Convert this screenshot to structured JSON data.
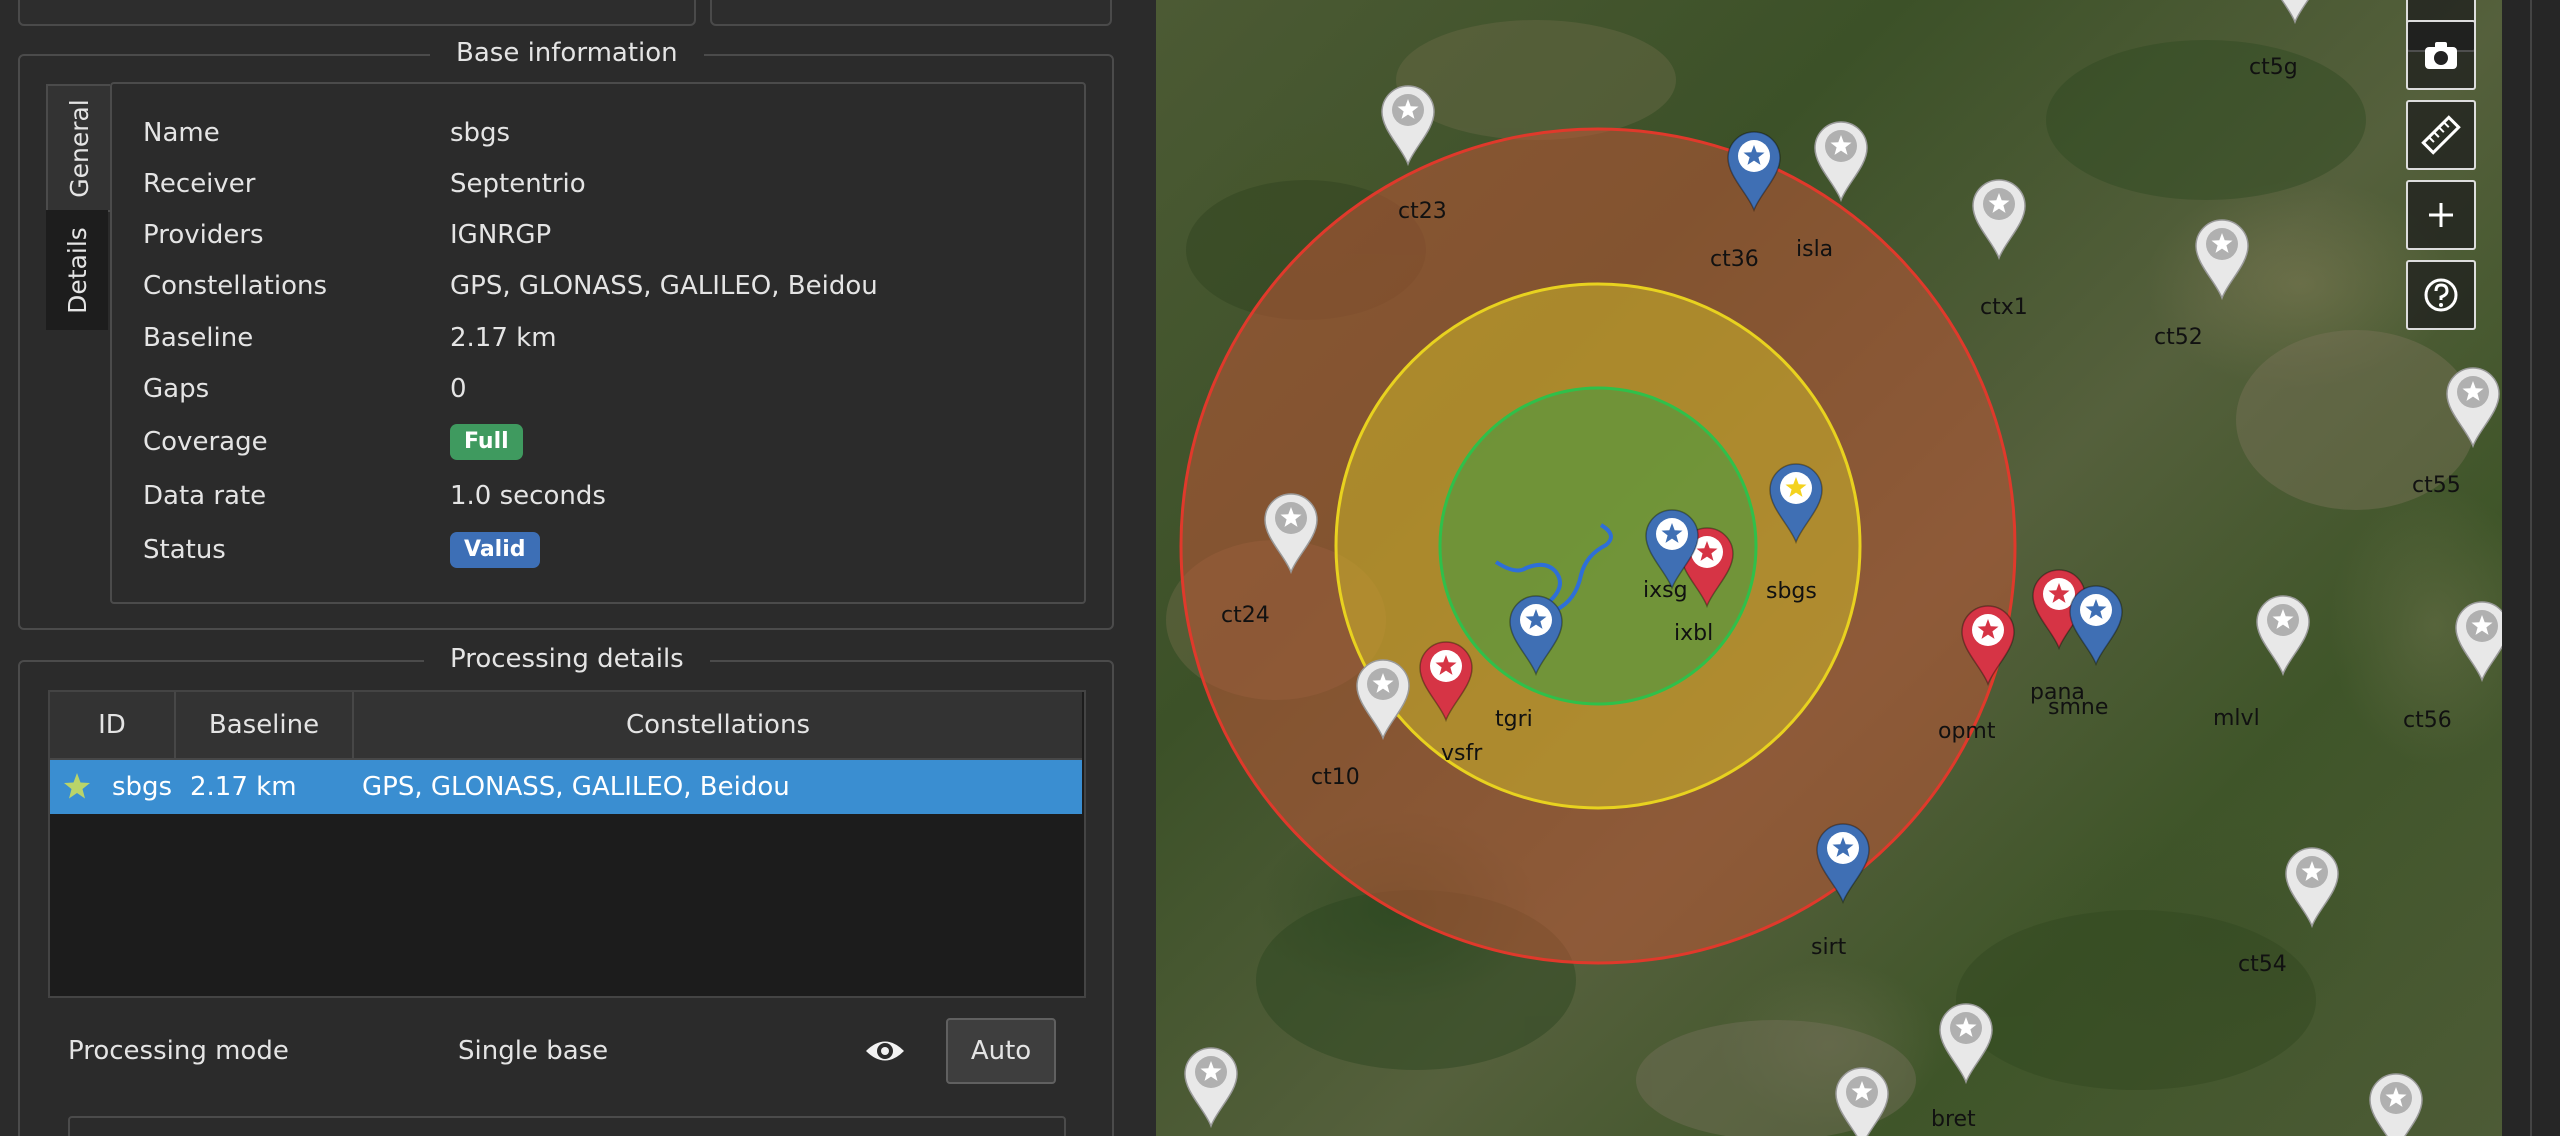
{
  "base_information": {
    "title": "Base information",
    "tabs": [
      {
        "label": "General"
      },
      {
        "label": "Details"
      }
    ],
    "rows": [
      {
        "label": "Name",
        "value": "sbgs"
      },
      {
        "label": "Receiver",
        "value": "Septentrio"
      },
      {
        "label": "Providers",
        "value": "IGNRGP"
      },
      {
        "label": "Constellations",
        "value": "GPS, GLONASS, GALILEO, Beidou"
      },
      {
        "label": "Baseline",
        "value": "2.17 km"
      },
      {
        "label": "Gaps",
        "value": "0"
      },
      {
        "label": "Coverage",
        "value": "Full"
      },
      {
        "label": "Data rate",
        "value": "1.0 seconds"
      },
      {
        "label": "Status",
        "value": "Valid"
      }
    ],
    "badge_colors": {
      "coverage": "#3f9a5f",
      "status": "#3d6fb6"
    }
  },
  "processing_details": {
    "title": "Processing details",
    "columns": [
      "ID",
      "Baseline",
      "Constellations"
    ],
    "rows": [
      {
        "icon": "star-icon",
        "id": "sbgs",
        "baseline": "2.17 km",
        "constellations": "GPS, GLONASS, GALILEO, Beidou"
      }
    ],
    "mode_label": "Processing mode",
    "mode_value": "Single base",
    "auto_label": "Auto",
    "selection_color": "#3a8ed1"
  },
  "map": {
    "markers": [
      {
        "label": "ct23",
        "color": "white"
      },
      {
        "label": "ct36",
        "color": "blue"
      },
      {
        "label": "isla",
        "color": "white"
      },
      {
        "label": "ctx1",
        "color": "white"
      },
      {
        "label": "ct52",
        "color": "white"
      },
      {
        "label": "ct5g",
        "color": "white"
      },
      {
        "label": "ct55",
        "color": "white"
      },
      {
        "label": "ct24",
        "color": "white"
      },
      {
        "label": "ixsg",
        "color": "red"
      },
      {
        "label": "ixbl",
        "color": "blue"
      },
      {
        "label": "sbgs",
        "color": "blue"
      },
      {
        "label": "tgri",
        "color": "blue"
      },
      {
        "label": "vsfr",
        "color": "red"
      },
      {
        "label": "ct10",
        "color": "white"
      },
      {
        "label": "opmt",
        "color": "red"
      },
      {
        "label": "pana",
        "color": "red"
      },
      {
        "label": "smne",
        "color": "blue"
      },
      {
        "label": "mlvl",
        "color": "white"
      },
      {
        "label": "ct56",
        "color": "white"
      },
      {
        "label": "sirt",
        "color": "blue"
      },
      {
        "label": "ct54",
        "color": "white"
      },
      {
        "label": "bret",
        "color": "white"
      }
    ],
    "circle_colors": {
      "outer": "#e0392b",
      "middle": "#e8d21f",
      "inner": "#2fc04a"
    },
    "pin_colors": {
      "blue": "#3f6fb4",
      "red": "#d63445",
      "white": "#e8e8e8"
    },
    "buttons": [
      {
        "name": "camera-icon"
      },
      {
        "name": "ruler-icon"
      },
      {
        "name": "plus-icon"
      },
      {
        "name": "help-icon"
      }
    ]
  }
}
